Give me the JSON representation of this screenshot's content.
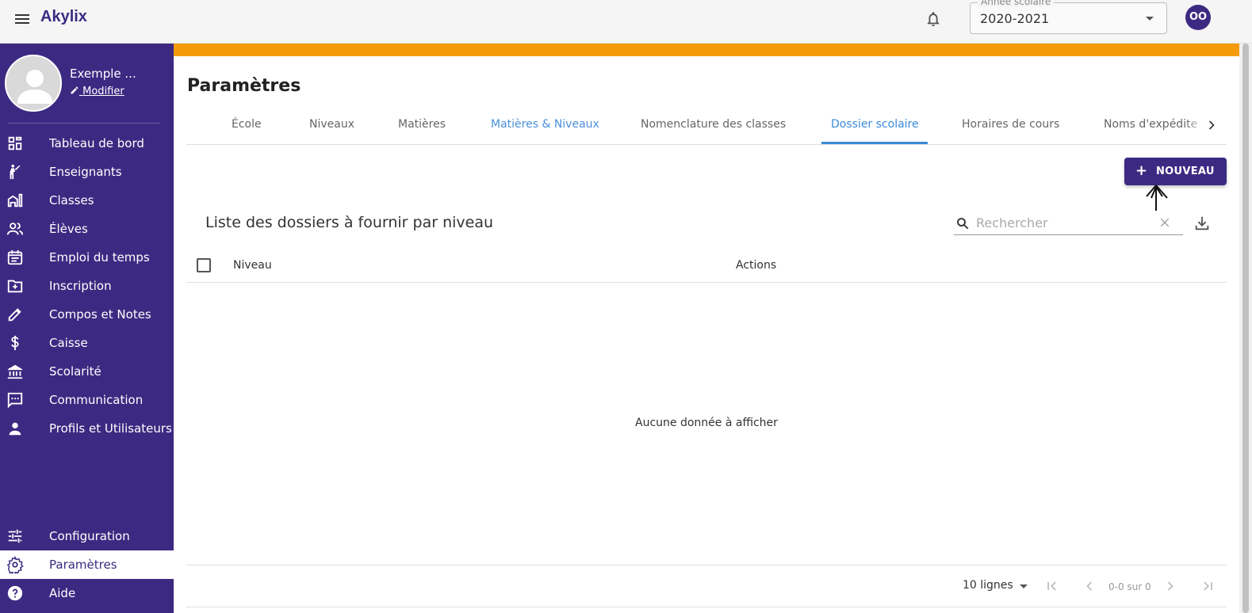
{
  "app": {
    "title": "Akylix"
  },
  "header": {
    "year_label": "Année scolaire",
    "year_value": "2020-2021",
    "user_initials": "OO"
  },
  "profile": {
    "name": "Exemple ...",
    "edit_label": "Modifier"
  },
  "sidebar": {
    "items": [
      {
        "label": "Tableau de bord",
        "icon": "dashboard-icon"
      },
      {
        "label": "Enseignants",
        "icon": "teacher-icon"
      },
      {
        "label": "Classes",
        "icon": "building-icon"
      },
      {
        "label": "Élèves",
        "icon": "students-icon"
      },
      {
        "label": "Emploi du temps",
        "icon": "calendar-icon"
      },
      {
        "label": "Inscription",
        "icon": "folder-plus-icon"
      },
      {
        "label": "Compos et Notes",
        "icon": "pencil-icon"
      },
      {
        "label": "Caisse",
        "icon": "dollar-icon"
      },
      {
        "label": "Scolarité",
        "icon": "bank-icon"
      },
      {
        "label": "Communication",
        "icon": "chat-icon"
      },
      {
        "label": "Profils et Utilisateurs",
        "icon": "person-icon"
      }
    ],
    "bottom_items": [
      {
        "label": "Configuration",
        "icon": "tune-icon"
      },
      {
        "label": "Paramètres",
        "icon": "gear-icon",
        "active": true
      },
      {
        "label": "Aide",
        "icon": "help-icon"
      }
    ]
  },
  "page": {
    "title": "Paramètres"
  },
  "tabs": [
    {
      "label": "École"
    },
    {
      "label": "Niveaux"
    },
    {
      "label": "Matières"
    },
    {
      "label": "Matières & Niveaux"
    },
    {
      "label": "Nomenclature des classes"
    },
    {
      "label": "Dossier scolaire",
      "active": true
    },
    {
      "label": "Horaires de cours"
    },
    {
      "label": "Noms d'expédite"
    }
  ],
  "actions": {
    "new_label": "NOUVEAU"
  },
  "list": {
    "title": "Liste des dossiers à fournir par niveau",
    "search_placeholder": "Rechercher",
    "columns": [
      "Niveau",
      "Actions"
    ],
    "empty_message": "Aucune donnée à afficher"
  },
  "pagination": {
    "rows_label": "10 lignes",
    "info": "0-0 sur 0"
  },
  "colors": {
    "primary": "#3c2a82",
    "accent": "#f59b0b",
    "tab_active": "#3a8ad7"
  }
}
